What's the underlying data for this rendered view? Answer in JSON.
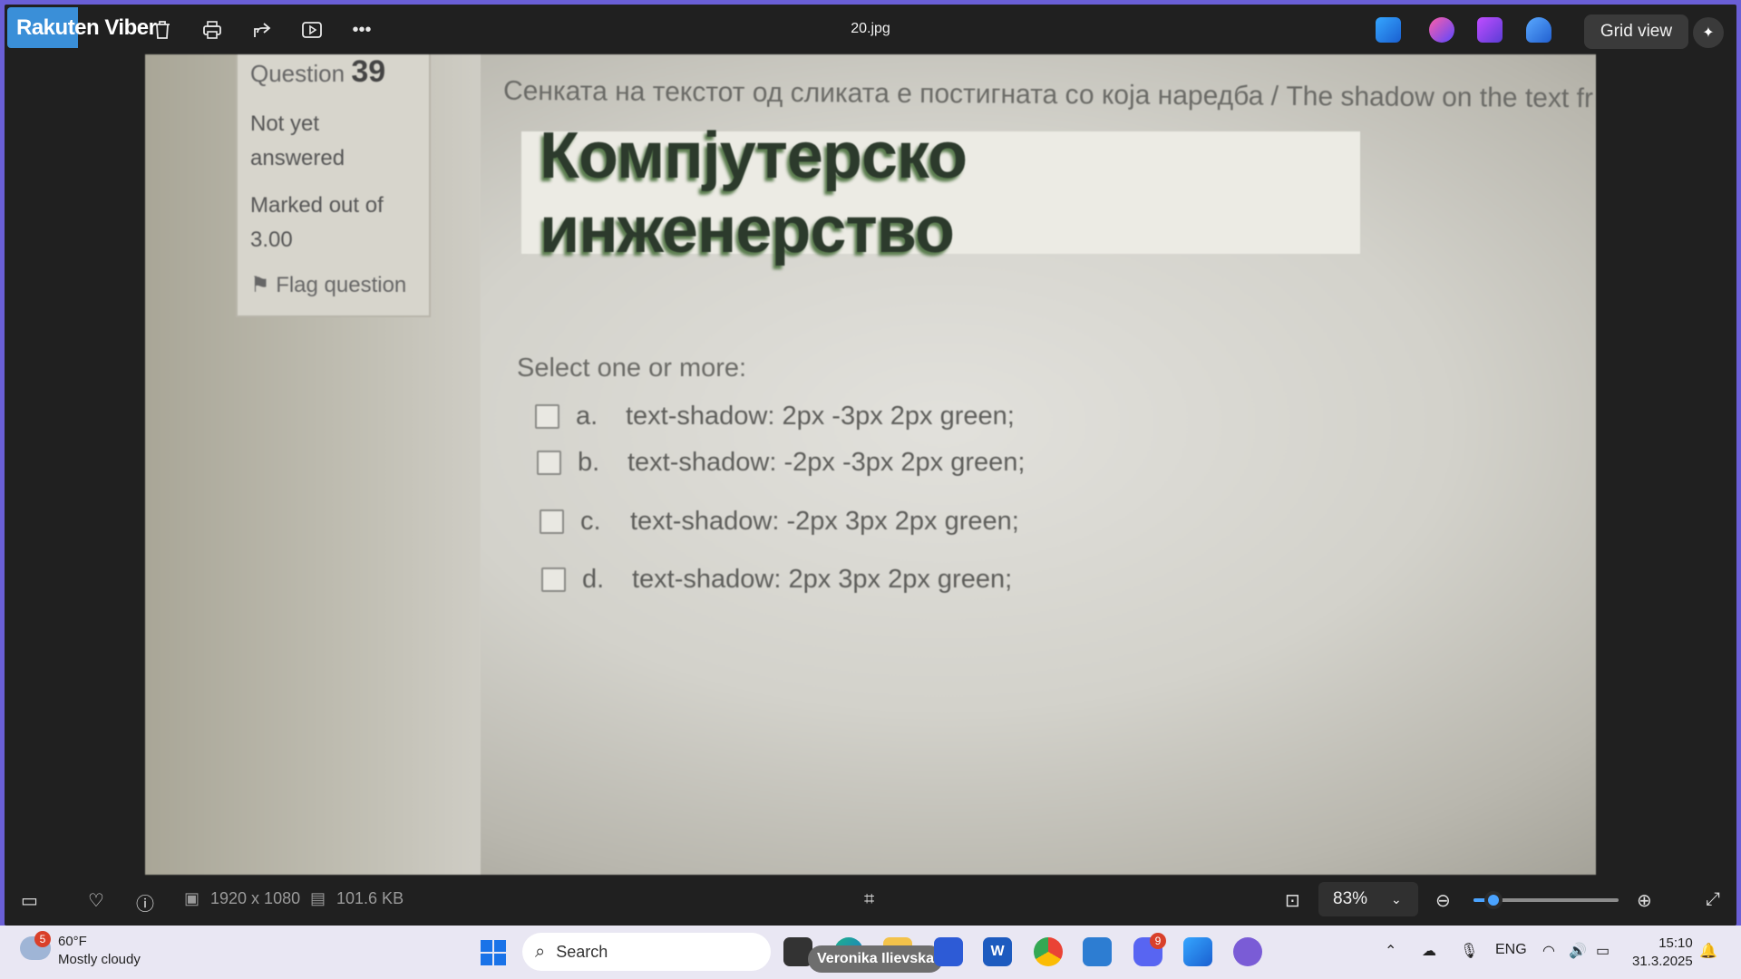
{
  "overlay_app": "Rakuten Viber",
  "toolbar": {
    "file_title": "20.jpg",
    "grid_view_label": "Grid view"
  },
  "photo": {
    "question_number_label": "Question",
    "question_number": "39",
    "status": "Not yet answered",
    "marked_out_of": "Marked out of 3.00",
    "flag_label": "Flag question",
    "question_text": "Сенката на текстот од сликата е постигната со која наредба / The shadow on the text fr",
    "title_image_text": "Компјутерско инженерство",
    "select_label": "Select one or more:",
    "options": [
      {
        "letter": "a.",
        "text": "text-shadow: 2px -3px 2px green;"
      },
      {
        "letter": "b.",
        "text": "text-shadow: -2px -3px 2px green;"
      },
      {
        "letter": "c.",
        "text": "text-shadow: -2px 3px 2px green;"
      },
      {
        "letter": "d.",
        "text": "text-shadow: 2px 3px 2px green;"
      }
    ]
  },
  "bottombar": {
    "dimensions": "1920 x 1080",
    "file_size": "101.6 KB",
    "zoom_value": "83%",
    "zoom_fraction": 0.14
  },
  "taskbar": {
    "weather_badge": "5",
    "temperature": "60°F",
    "weather": "Mostly cloudy",
    "search_placeholder": "Search",
    "tooltip": "Veronika Ilievska",
    "discord_badge": "9",
    "language": "ENG",
    "time": "15:10",
    "date": "31.3.2025"
  },
  "colors": {
    "accent": "#4aa3ff",
    "window_bg": "#202020",
    "desktop": "#6a5fd6"
  }
}
